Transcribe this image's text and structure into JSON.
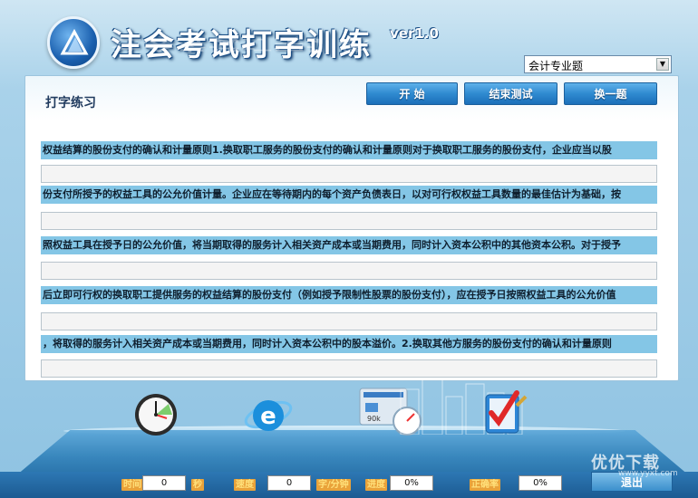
{
  "header": {
    "title": "注会考试打字训练",
    "version": "ver1.0"
  },
  "category_select": {
    "selected": "会计专业题"
  },
  "panel": {
    "title": "打字练习",
    "buttons": {
      "start": "开  始",
      "end_test": "结束测试",
      "change": "换一题"
    },
    "lines": [
      "权益结算的股份支付的确认和计量原则1.换取职工服务的股份支付的确认和计量原则对于换取职工服务的股份支付，企业应当以股",
      "份支付所授予的权益工具的公允价值计量。企业应在等待期内的每个资产负债表日，以对可行权权益工具数量的最佳估计为基础，按",
      "照权益工具在授予日的公允价值，将当期取得的服务计入相关资产成本或当期费用，同时计入资本公积中的其他资本公积。对于授予",
      "后立即可行权的换取职工提供服务的权益结算的股份支付（例如授予限制性股票的股份支付），应在授予日按照权益工具的公允价值",
      "，将取得的服务计入相关资产成本或当期费用，同时计入资本公积中的股本溢价。2.换取其他方服务的股份支付的确认和计量原则"
    ]
  },
  "icons": {
    "clock": "clock-icon",
    "ie": "browser-icon",
    "speed": "speedometer-icon",
    "check": "checkmark-icon"
  },
  "stats": {
    "time_label": "时间",
    "time_value": "0",
    "time_unit": "秒",
    "speed_label": "速度",
    "speed_value": "0",
    "speed_unit": "字/分钟",
    "progress_label": "进度",
    "progress_value": "0%",
    "accuracy_label": "正确率",
    "accuracy_value": "0%"
  },
  "exit_label": "退出",
  "watermark": {
    "text": "优优下载",
    "url": "www.yyxt.com"
  }
}
